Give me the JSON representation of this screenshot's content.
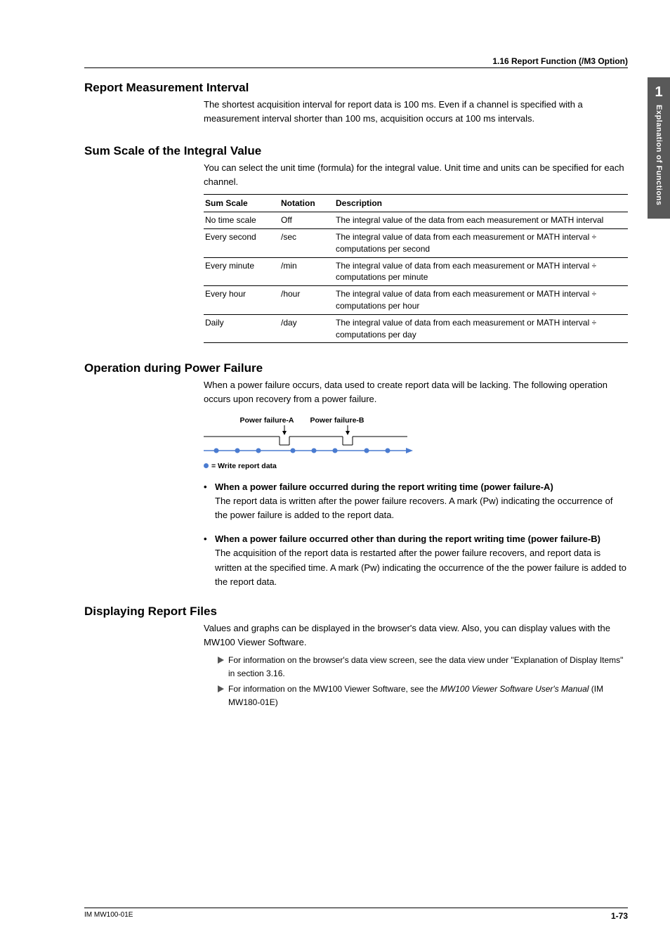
{
  "header": {
    "crumb": "1.16  Report Function (/M3 Option)"
  },
  "sideTab": {
    "num": "1",
    "label": "Explanation of Functions"
  },
  "s1": {
    "title": "Report Measurement Interval",
    "p1": "The shortest acquisition interval for report data is 100 ms. Even if a channel is specified with a measurement interval shorter than 100 ms, acquisition occurs at 100 ms intervals."
  },
  "s2": {
    "title": "Sum Scale of the Integral Value",
    "p1": "You can select the unit time (formula) for the integral value. Unit time and units can be specified for each channel.",
    "table": {
      "h1": "Sum Scale",
      "h2": "Notation",
      "h3": "Description",
      "rows": [
        {
          "c1": "No time scale",
          "c2": "Off",
          "c3": "The integral value of the data from each measurement or MATH interval"
        },
        {
          "c1": "Every second",
          "c2": "/sec",
          "c3": "The integral value of data from each measurement or MATH interval ÷ computations per second"
        },
        {
          "c1": "Every minute",
          "c2": "/min",
          "c3": "The integral value of data from each measurement or MATH interval ÷ computations per minute"
        },
        {
          "c1": "Every hour",
          "c2": "/hour",
          "c3": "The integral value of data from each measurement or MATH interval ÷ computations per hour"
        },
        {
          "c1": "Daily",
          "c2": "/day",
          "c3": "The integral value of data from each measurement or MATH interval ÷ computations per day"
        }
      ]
    }
  },
  "s3": {
    "title": "Operation during Power Failure",
    "p1": "When a power failure occurs, data used to create report data will be lacking. The following operation occurs upon recovery from a power failure.",
    "diagram": {
      "labelA": "Power failure-A",
      "labelB": "Power failure-B",
      "legend": "= Write report data"
    },
    "b1": {
      "lead": "When a power failure occurred during the report writing time (power failure-A)",
      "body": "The report data is written after the power failure recovers. A mark (Pw) indicating the occurrence of the power failure is added to the report data."
    },
    "b2": {
      "lead": "When a power failure occurred other than during the report writing time (power failure-B)",
      "body": "The acquisition of the report data is restarted after the power failure recovers, and report data is written at the specified time. A mark (Pw) indicating the occurrence of the the power failure is added to the report data."
    }
  },
  "s4": {
    "title": "Displaying Report Files",
    "p1": "Values and graphs can be displayed in the browser's data view. Also, you can display values with the MW100 Viewer Software.",
    "ref1a": "For information on the browser's data view screen, see the data view under \"Explanation of Display Items\" in section 3.16.",
    "ref2a": "For information on the MW100 Viewer Software, see the ",
    "ref2i": "MW100 Viewer Software User's Manual",
    "ref2b": " (IM MW180-01E)"
  },
  "footer": {
    "left": "IM MW100-01E",
    "right": "1-73"
  }
}
